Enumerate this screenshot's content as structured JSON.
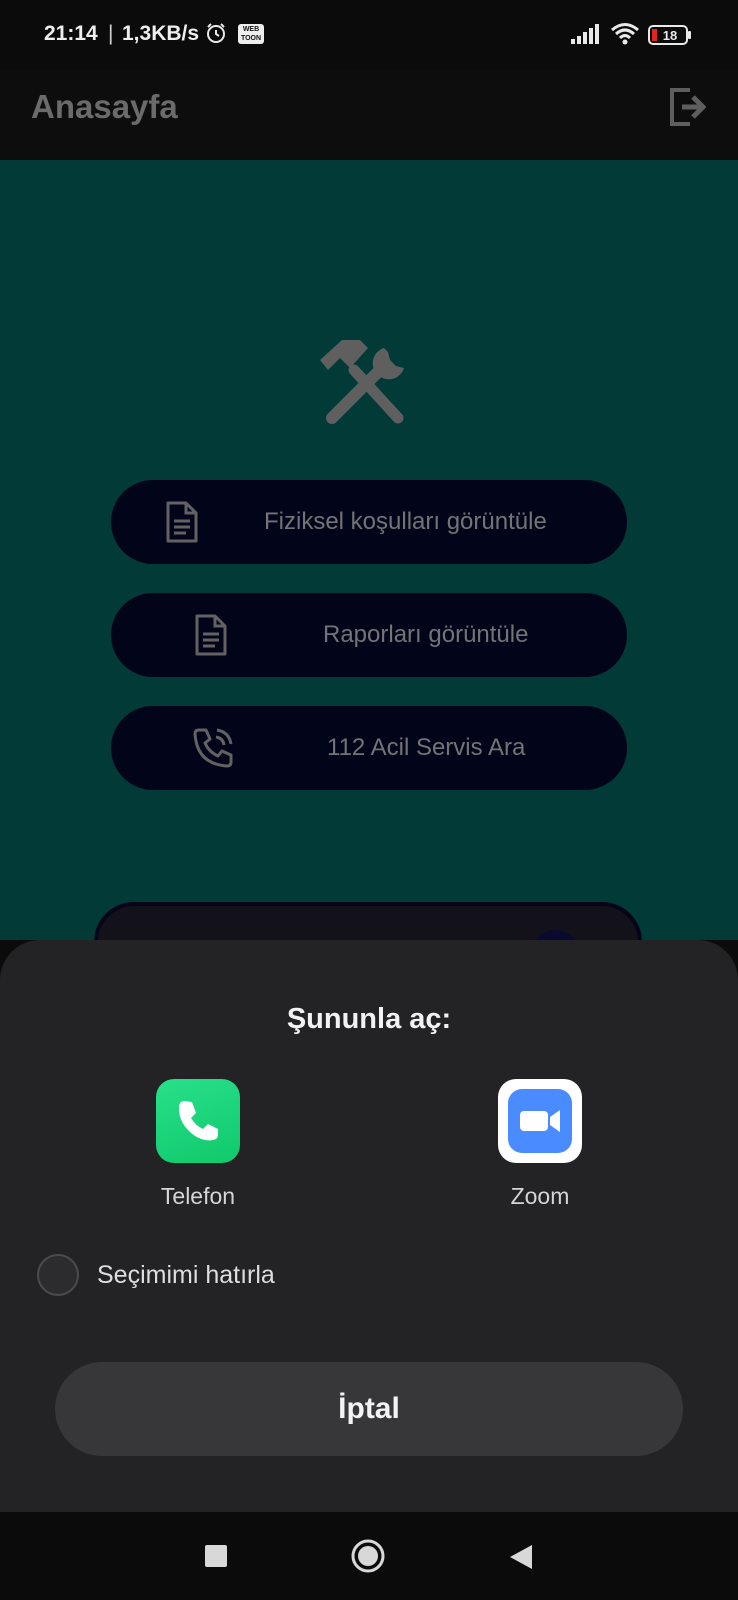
{
  "status_bar": {
    "time": "21:14",
    "separator": "|",
    "network_speed": "1,3KB/s",
    "webtoon_badge": "WEB TOON",
    "battery_level": "18",
    "icons": [
      "alarm-icon",
      "webtoon-icon",
      "signal-icon",
      "wifi-icon",
      "battery-icon"
    ]
  },
  "app_bar": {
    "title": "Anasayfa",
    "action_icon": "logout-icon"
  },
  "main": {
    "header_icon": "hammer-wrench-icon",
    "buttons": [
      {
        "label": "Fiziksel koşulları görüntüle",
        "icon": "document-icon"
      },
      {
        "label": "Raporları görüntüle",
        "icon": "document-icon"
      },
      {
        "label": "112 Acil Servis Ara",
        "icon": "phone-ringing-icon"
      }
    ]
  },
  "chooser": {
    "title": "Şununla aç:",
    "apps": [
      {
        "label": "Telefon",
        "icon": "phone-app-icon",
        "color": "#1fd67a"
      },
      {
        "label": "Zoom",
        "icon": "zoom-app-icon",
        "color": "#4a8cff"
      }
    ],
    "remember_label": "Seçimimi hatırla",
    "remember_checked": false,
    "cancel_label": "İptal"
  },
  "nav_bar": {
    "icons": [
      "recents-icon",
      "home-icon",
      "back-icon"
    ]
  },
  "colors": {
    "teal_background": "#013a36",
    "pill_background": "#02041a",
    "sheet_background": "#232325",
    "status_background": "#0b0b0b"
  }
}
